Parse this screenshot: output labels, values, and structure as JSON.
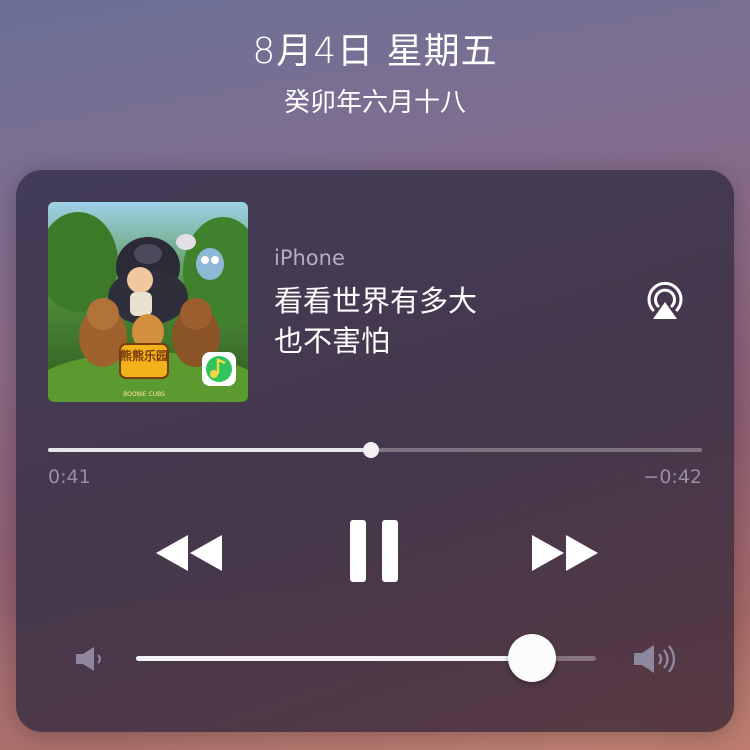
{
  "lockscreen": {
    "date": "8月4日 星期五",
    "lunar_date": "癸卯年六月十八"
  },
  "now_playing": {
    "device": "iPhone",
    "title": "看看世界有多大",
    "subtitle": "也不害怕",
    "artwork": {
      "title_text": "熊熊乐园",
      "footer_text": "BOONIE CUBS",
      "app_badge_icon": "qq-music-icon"
    },
    "elapsed": "0:41",
    "remaining": "−0:42",
    "progress_fraction": 0.494,
    "volume_fraction": 0.86,
    "icons": {
      "airplay": "airplay-icon",
      "rewind": "rewind-icon",
      "pause": "pause-icon",
      "forward": "fast-forward-icon",
      "volume_low": "volume-low-icon",
      "volume_high": "volume-high-icon"
    }
  },
  "colors": {
    "card_background": "#3e3852",
    "secondary_text": "#968ea6",
    "track": "#ffffff4d",
    "fill": "#f4f2f6"
  }
}
